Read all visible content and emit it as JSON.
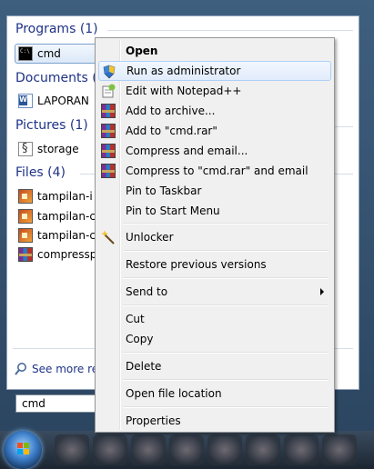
{
  "results": {
    "groups": [
      {
        "header": "Programs (1)",
        "items": [
          {
            "label": "cmd",
            "icon": "cmd-icon"
          }
        ]
      },
      {
        "header": "Documents (",
        "items": [
          {
            "label": "LAPORAN",
            "icon": "word-document-icon"
          }
        ]
      },
      {
        "header": "Pictures (1)",
        "items": [
          {
            "label": "storage",
            "icon": "picture-icon"
          }
        ]
      },
      {
        "header": "Files (4)",
        "items": [
          {
            "label": "tampilan-i",
            "icon": "image-file-icon"
          },
          {
            "label": "tampilan-c",
            "icon": "image-file-icon"
          },
          {
            "label": "tampilan-c",
            "icon": "image-file-icon"
          },
          {
            "label": "compressp",
            "icon": "winrar-archive-icon"
          }
        ]
      }
    ],
    "see_more": "See more resu"
  },
  "search": {
    "value": "cmd"
  },
  "context_menu": {
    "items": [
      {
        "label": "Open",
        "bold": true
      },
      {
        "label": "Run as administrator",
        "icon": "uac-shield-icon"
      },
      {
        "label": "Edit with Notepad++",
        "icon": "notepad-plus-icon"
      },
      {
        "label": "Add to archive...",
        "icon": "winrar-icon"
      },
      {
        "label": "Add to \"cmd.rar\"",
        "icon": "winrar-icon"
      },
      {
        "label": "Compress and email...",
        "icon": "winrar-icon"
      },
      {
        "label": "Compress to \"cmd.rar\" and email",
        "icon": "winrar-icon"
      },
      {
        "label": "Pin to Taskbar"
      },
      {
        "label": "Pin to Start Menu"
      },
      {
        "label": "Unlocker",
        "icon": "unlocker-wand-icon"
      },
      {
        "label": "Restore previous versions"
      },
      {
        "label": "Send to",
        "submenu": true
      },
      {
        "label": "Cut"
      },
      {
        "label": "Copy"
      },
      {
        "label": "Delete"
      },
      {
        "label": "Open file location"
      },
      {
        "label": "Properties"
      }
    ]
  },
  "colors": {
    "header_text": "#1e3287",
    "hover_border": "#aecff7",
    "menu_bg": "#f0f0f0"
  }
}
